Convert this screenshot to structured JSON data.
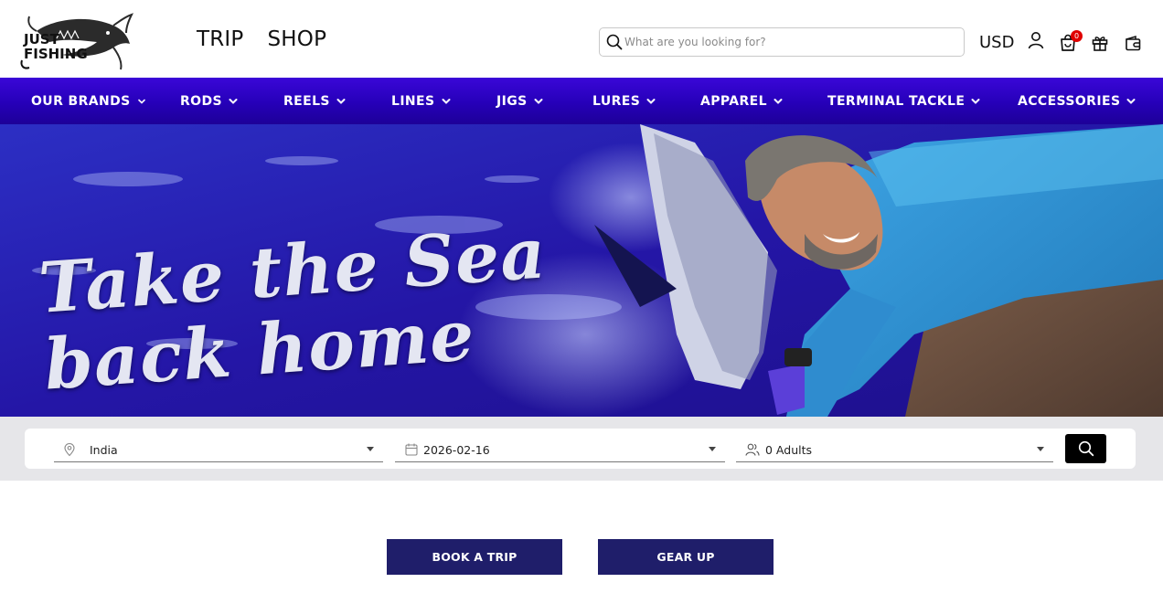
{
  "brand": {
    "logo_line1": "JUST",
    "logo_line2": "FISHING"
  },
  "top_nav": [
    {
      "label": "TRIP"
    },
    {
      "label": "SHOP"
    }
  ],
  "search": {
    "placeholder": "What are you looking for?",
    "value": ""
  },
  "header": {
    "currency": "USD",
    "cart_count": "0"
  },
  "categories": [
    {
      "label": "OUR BRANDS"
    },
    {
      "label": "RODS"
    },
    {
      "label": "REELS"
    },
    {
      "label": "LINES"
    },
    {
      "label": "JIGS"
    },
    {
      "label": "LURES"
    },
    {
      "label": "APPAREL"
    },
    {
      "label": "TERMINAL TACKLE"
    },
    {
      "label": "ACCESSORIES"
    }
  ],
  "hero": {
    "line1": "Take the Sea",
    "line2": "back home"
  },
  "booking": {
    "location": "India",
    "date": "2026-02-16",
    "guests": "0 Adults"
  },
  "cta": {
    "book_trip": "BOOK A TRIP",
    "gear_up": "GEAR UP"
  },
  "colors": {
    "nav_bg": "#2a04c6",
    "cta_bg": "#1f1e6a",
    "badge": "#e00000"
  },
  "icons": [
    "search-icon",
    "user-icon",
    "cart-icon",
    "gift-icon",
    "wallet-icon",
    "location-pin-icon",
    "calendar-icon",
    "users-icon",
    "chevron-down-icon"
  ]
}
